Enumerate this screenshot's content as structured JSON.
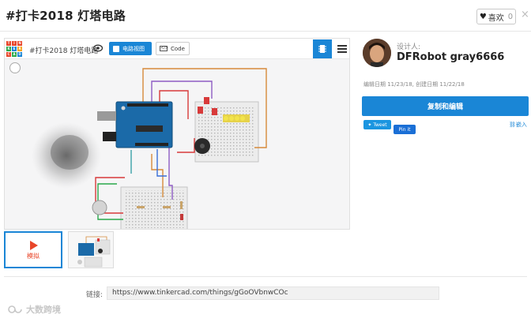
{
  "header": {
    "title": "#打卡2018 灯塔电路",
    "like_label": "喜欢",
    "like_count": "0",
    "close": "×"
  },
  "viewer": {
    "logo_letters": [
      "T",
      "I",
      "N",
      "K",
      "E",
      "R",
      "C",
      "A",
      "D"
    ],
    "design_name": "#打卡2018 灯塔电路",
    "view_label": "电路视图",
    "code_label": "Code",
    "code_icon": "</>"
  },
  "thumbnails": {
    "simulate_label": "模拟"
  },
  "link": {
    "label": "链接:",
    "url": "https://www.tinkercad.com/things/gGoOVbnwCOc"
  },
  "designer": {
    "label": "设计人:",
    "name": "DFRobot gray6666",
    "dates": "编辑日期 11/23/18, 创建日期 11/22/18"
  },
  "actions": {
    "copy_label": "复制和编辑",
    "tweet_label": "Tweet",
    "pin_label": "Pin it",
    "embed_label": "嵌入"
  },
  "watermark": {
    "text": "大数跨境"
  },
  "colors": {
    "accent": "#1a86d6",
    "simulate": "#e8462a",
    "logo": [
      "#e8462a",
      "#e8462a",
      "#e8462a",
      "#2aa84a",
      "#1a86d6",
      "#f5a623",
      "#e8462a",
      "#2aa84a",
      "#1a86d6"
    ]
  }
}
